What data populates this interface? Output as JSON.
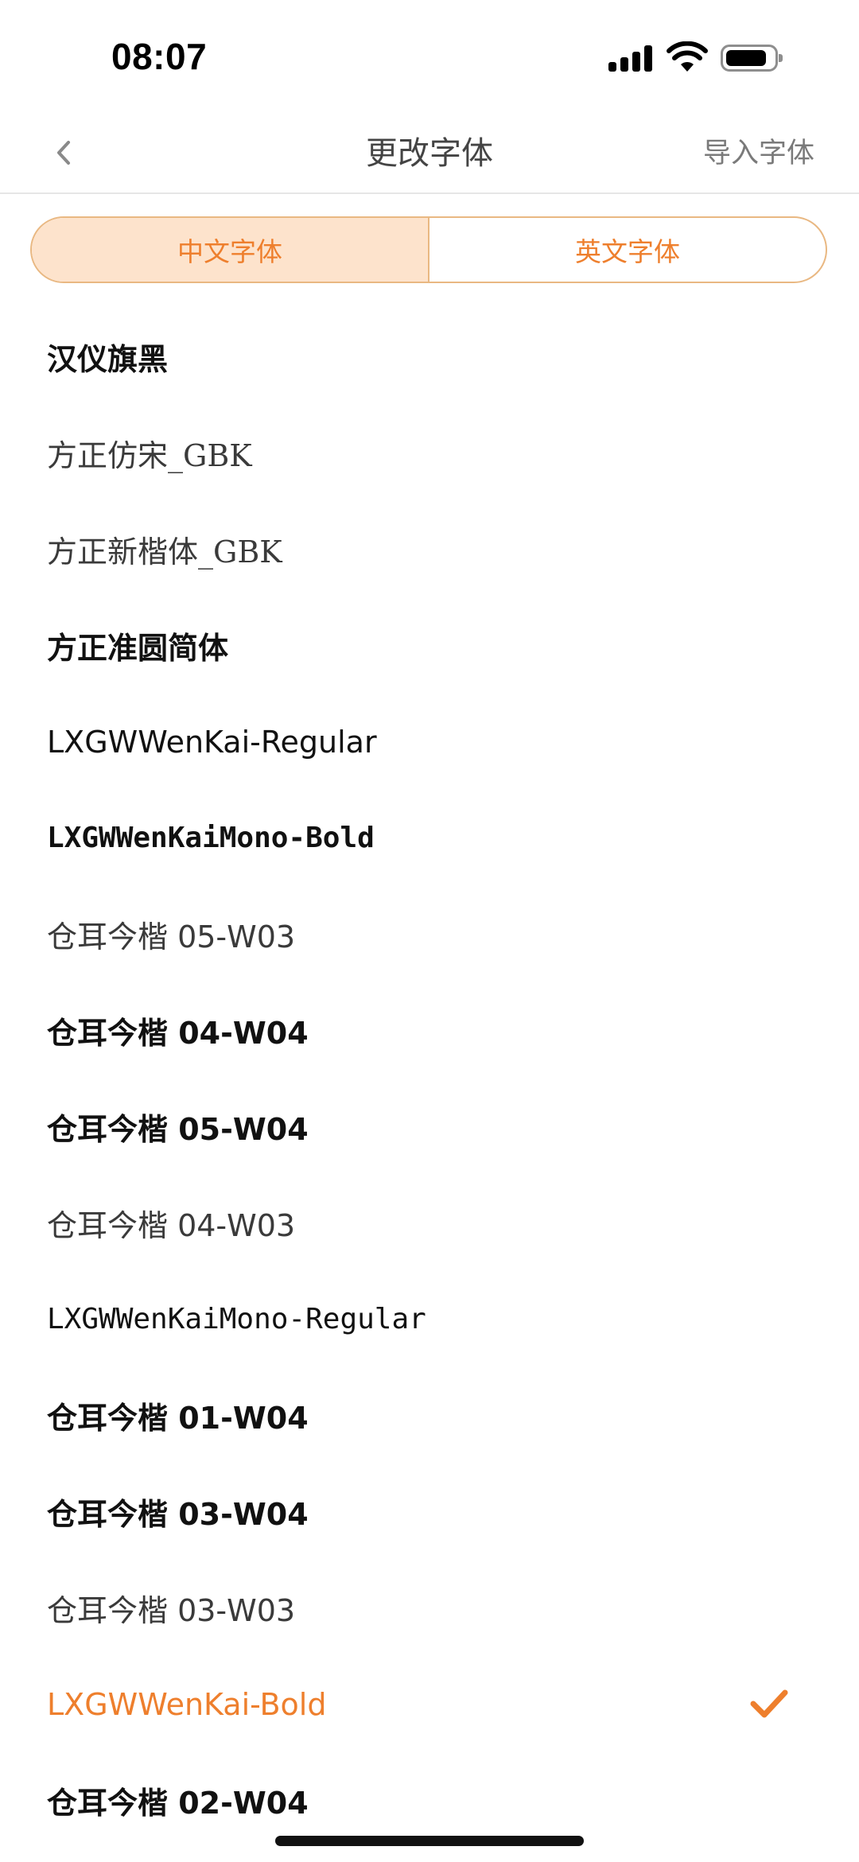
{
  "status_bar": {
    "time": "08:07"
  },
  "nav": {
    "title": "更改字体",
    "import_label": "导入字体"
  },
  "tabs": [
    {
      "label": "中文字体",
      "active": true
    },
    {
      "label": "英文字体",
      "active": false
    }
  ],
  "fonts": [
    {
      "name": "汉仪旗黑"
    },
    {
      "name": "方正仿宋_GBK"
    },
    {
      "name": "方正新楷体_GBK"
    },
    {
      "name": "方正准圆简体"
    },
    {
      "name": "LXGWWenKai-Regular"
    },
    {
      "name": "LXGWWenKaiMono-Bold"
    },
    {
      "name": "仓耳今楷 05-W03"
    },
    {
      "name": "仓耳今楷 04-W04"
    },
    {
      "name": "仓耳今楷 05-W04"
    },
    {
      "name": "仓耳今楷 04-W03"
    },
    {
      "name": "LXGWWenKaiMono-Regular"
    },
    {
      "name": "仓耳今楷 01-W04"
    },
    {
      "name": "仓耳今楷 03-W04"
    },
    {
      "name": "仓耳今楷 03-W03"
    },
    {
      "name": "LXGWWenKai-Bold",
      "selected": true
    },
    {
      "name": "仓耳今楷 02-W04"
    }
  ],
  "colors": {
    "accent": "#ee7f2d",
    "tab_active_bg": "#fde3cc",
    "tab_border": "#e9b882"
  },
  "icons": {
    "back": "chevron-left-icon",
    "selected": "checkmark-icon",
    "signal": "cellular-signal-icon",
    "wifi": "wifi-icon",
    "battery": "battery-icon"
  }
}
